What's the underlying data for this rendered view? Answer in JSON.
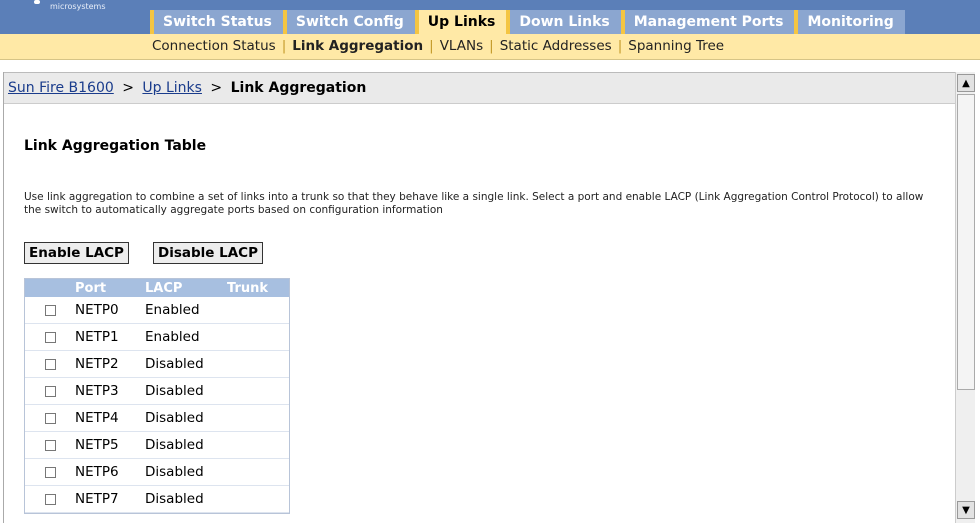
{
  "brand": {
    "logo_text": "microsystems"
  },
  "tabs": [
    {
      "label": "Switch Status",
      "active": false
    },
    {
      "label": "Switch Config",
      "active": false
    },
    {
      "label": "Up Links",
      "active": true
    },
    {
      "label": "Down Links",
      "active": false
    },
    {
      "label": "Management Ports",
      "active": false
    },
    {
      "label": "Monitoring",
      "active": false
    }
  ],
  "subnav": [
    {
      "label": "Connection Status",
      "active": false
    },
    {
      "label": "Link Aggregation",
      "active": true
    },
    {
      "label": "VLANs",
      "active": false
    },
    {
      "label": "Static Addresses",
      "active": false
    },
    {
      "label": "Spanning Tree",
      "active": false
    }
  ],
  "breadcrumb": {
    "items": [
      "Sun Fire B1600",
      "Up Links"
    ],
    "separator": ">",
    "current": "Link Aggregation"
  },
  "section": {
    "title": "Link Aggregation Table",
    "description": "Use link aggregation to combine a set of links into a trunk so that they behave like a single link. Select a port and enable LACP (Link Aggregation Control Protocol) to allow the switch to automatically aggregate ports based on configuration information"
  },
  "buttons": {
    "enable": "Enable LACP",
    "disable": "Disable LACP"
  },
  "table": {
    "headers": {
      "port": "Port",
      "lacp": "LACP",
      "trunk": "Trunk"
    },
    "rows": [
      {
        "port": "NETP0",
        "lacp": "Enabled",
        "trunk": ""
      },
      {
        "port": "NETP1",
        "lacp": "Enabled",
        "trunk": ""
      },
      {
        "port": "NETP2",
        "lacp": "Disabled",
        "trunk": ""
      },
      {
        "port": "NETP3",
        "lacp": "Disabled",
        "trunk": ""
      },
      {
        "port": "NETP4",
        "lacp": "Disabled",
        "trunk": ""
      },
      {
        "port": "NETP5",
        "lacp": "Disabled",
        "trunk": ""
      },
      {
        "port": "NETP6",
        "lacp": "Disabled",
        "trunk": ""
      },
      {
        "port": "NETP7",
        "lacp": "Disabled",
        "trunk": ""
      }
    ]
  },
  "colors": {
    "header_blue": "#5b7fb8",
    "tab_blue": "#8ba6d0",
    "accent_yellow": "#ffe9a6",
    "table_header": "#a7bfe0"
  }
}
